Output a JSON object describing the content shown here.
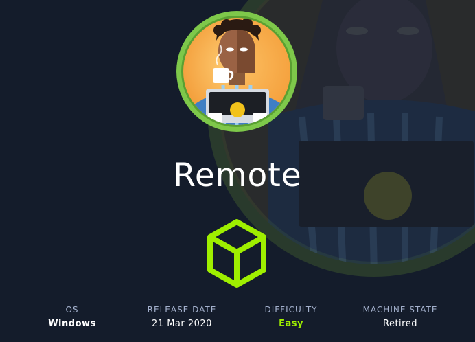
{
  "machine": {
    "name": "Remote",
    "avatar_icon": "coffee-person-avatar-icon",
    "type_icon": "cube-icon"
  },
  "stats": {
    "os": {
      "label": "OS",
      "value": "Windows"
    },
    "release_date": {
      "label": "RELEASE DATE",
      "value": "21 Mar 2020"
    },
    "difficulty": {
      "label": "DIFFICULTY",
      "value": "Easy"
    },
    "machine_state": {
      "label": "MACHINE STATE",
      "value": "Retired"
    }
  },
  "colors": {
    "background": "#141d2b",
    "accent_green": "#9fef00",
    "ring_green": "#7ec84a",
    "label_gray": "#a4b1cd",
    "divider": "#7fa842"
  }
}
